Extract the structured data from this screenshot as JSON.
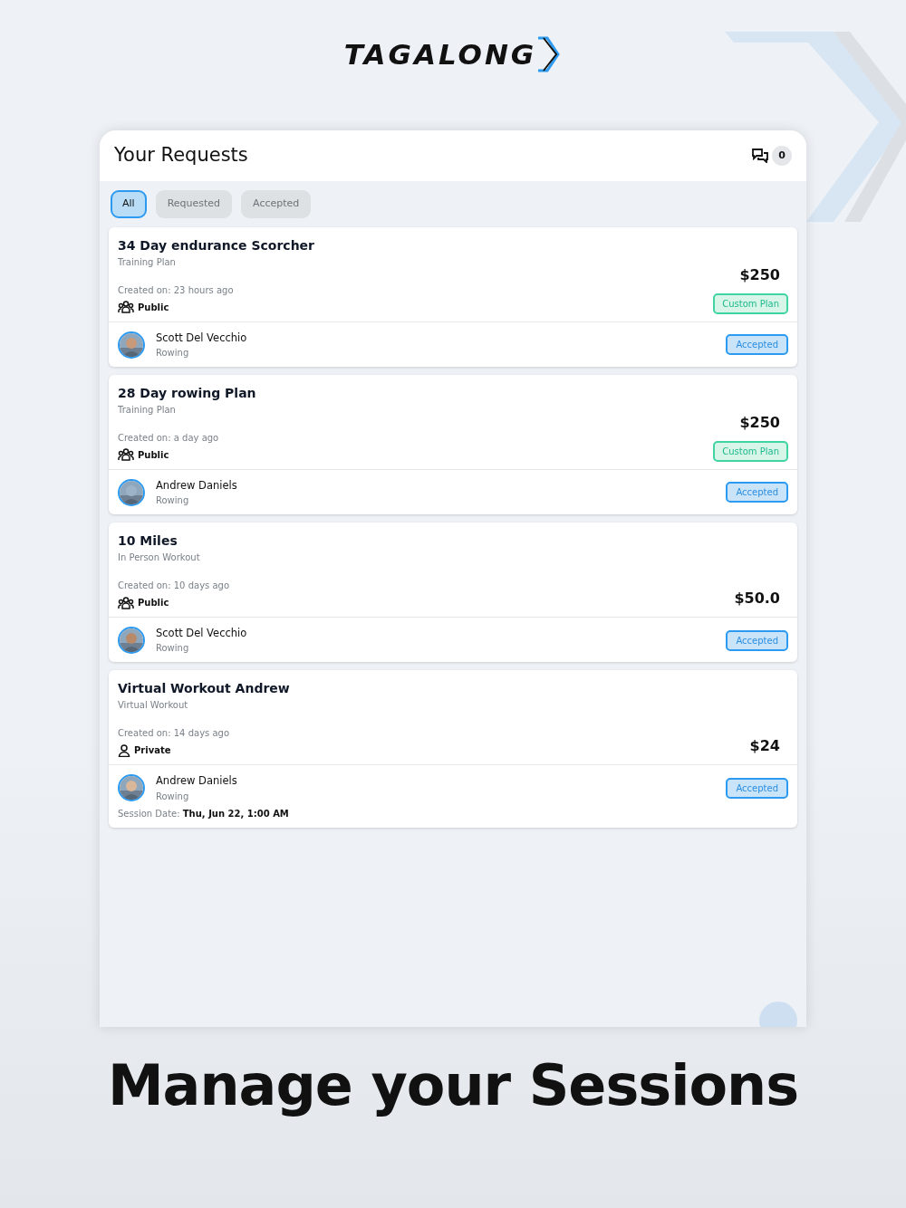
{
  "brand": {
    "logo": "TAGALONG"
  },
  "screen": {
    "title": "Your Requests",
    "messages_count": "0",
    "filters": [
      {
        "label": "All",
        "selected": true
      },
      {
        "label": "Requested",
        "selected": false
      },
      {
        "label": "Accepted",
        "selected": false
      }
    ],
    "requests": [
      {
        "title": "34 Day endurance Scorcher",
        "type": "Training Plan",
        "created": "Created on: 23 hours ago",
        "visibility": "Public",
        "kind": "public",
        "price": "$250",
        "tag": "Custom Plan",
        "person": "Scott Del Vecchio",
        "sport": "Rowing",
        "status": "Accepted"
      },
      {
        "title": "28 Day rowing Plan",
        "type": "Training Plan",
        "created": "Created on: a day ago",
        "visibility": "Public",
        "kind": "public",
        "price": "$250",
        "tag": "Custom Plan",
        "person": "Andrew Daniels",
        "sport": "Rowing",
        "status": "Accepted"
      },
      {
        "title": "10 Miles",
        "type": "In Person Workout",
        "created": "Created on: 10 days ago",
        "visibility": "Public",
        "kind": "public",
        "price": "$50.0",
        "person": "Scott Del Vecchio",
        "sport": "Rowing",
        "status": "Accepted"
      },
      {
        "title": "Virtual Workout Andrew",
        "type": "Virtual Workout",
        "created": "Created on: 14 days ago",
        "visibility": "Private",
        "kind": "private",
        "price": "$24",
        "person": "Andrew Daniels",
        "sport": "Rowing",
        "status": "Accepted",
        "session_label": "Session Date:",
        "session_date": "Thu, Jun 22, 1:00 AM"
      }
    ]
  },
  "headline": "Manage your Sessions"
}
